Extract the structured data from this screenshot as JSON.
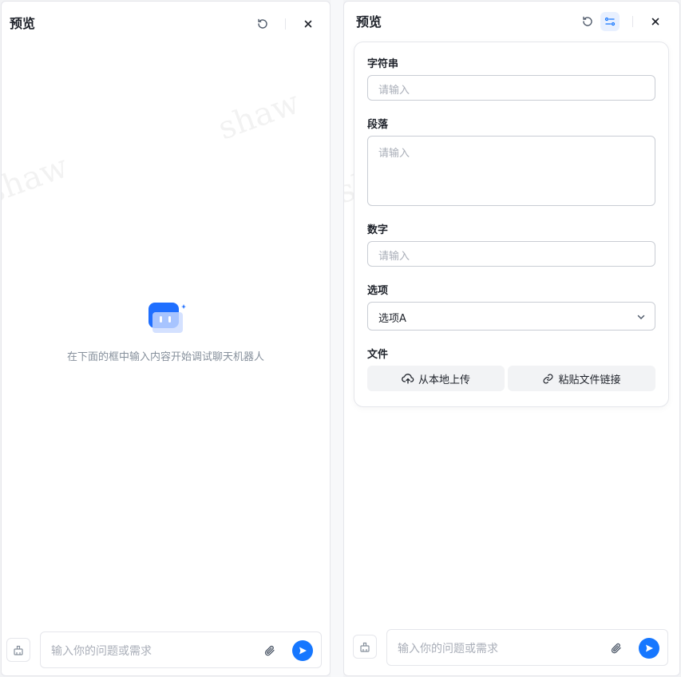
{
  "left_panel": {
    "title": "预览",
    "empty_message": "在下面的框中输入内容开始调试聊天机器人",
    "input_placeholder": "输入你的问题或需求",
    "watermark": "shaw"
  },
  "right_panel": {
    "title": "预览",
    "form": {
      "string_label": "字符串",
      "string_placeholder": "请输入",
      "paragraph_label": "段落",
      "paragraph_placeholder": "请输入",
      "number_label": "数字",
      "number_placeholder": "请输入",
      "select_label": "选项",
      "select_value": "选项A",
      "file_label": "文件",
      "upload_local": "从本地上传",
      "paste_link": "粘贴文件链接"
    },
    "input_placeholder": "输入你的问题或需求",
    "watermark": "shaw"
  },
  "colors": {
    "accent": "#1677ff",
    "border": "#e5e6eb",
    "placeholder": "#a9aeb8"
  },
  "icons": [
    "refresh-icon",
    "settings-sliders-icon",
    "close-icon",
    "bot-icon",
    "broom-icon",
    "paperclip-icon",
    "send-icon",
    "cloud-upload-icon",
    "link-icon",
    "chevron-down-icon"
  ]
}
